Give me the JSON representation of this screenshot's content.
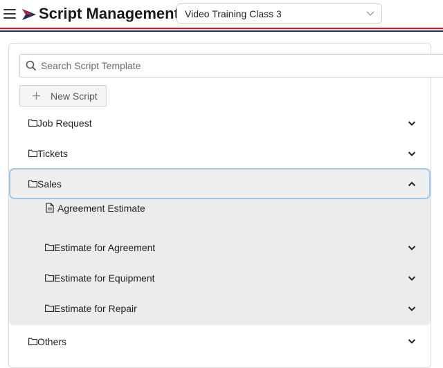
{
  "header": {
    "title": "Script Management",
    "selected_class": "Video Training Class 3",
    "brand_colors": {
      "red": "#c8202b",
      "navy": "#1b2a6b"
    }
  },
  "search": {
    "placeholder": "Search Script Template",
    "value": ""
  },
  "toolbar": {
    "new_script_label": "New Script"
  },
  "tree": {
    "job_request": {
      "label": "Job Request",
      "expanded": false
    },
    "tickets": {
      "label": "Tickets",
      "expanded": false
    },
    "sales": {
      "label": "Sales",
      "expanded": true,
      "file_agreement_estimate": "Agreement Estimate",
      "estimate_for_agreement": "Estimate for Agreement",
      "estimate_for_equipment": "Estimate for Equipment",
      "estimate_for_repair": "Estimate for Repair"
    },
    "others": {
      "label": "Others",
      "expanded": false
    }
  },
  "icons": {
    "menu": "hamburger-menu-icon",
    "logo": "flag-logo-icon",
    "search": "search-icon",
    "add": "plus-icon",
    "folder": "folder-icon",
    "file": "document-icon",
    "expand": "chevron-down-icon",
    "collapse": "chevron-up-icon"
  }
}
